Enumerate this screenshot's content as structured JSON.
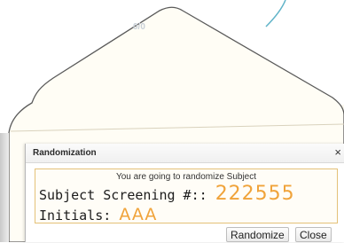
{
  "background": {
    "faint_text": "0/0"
  },
  "dialog": {
    "title": "Randomization",
    "close_glyph": "×",
    "intro": "You are going to randomize Subject",
    "screening_label": "Subject Screening #::",
    "screening_value": "222555",
    "initials_label": "Initials:",
    "initials_value": "AAA",
    "buttons": {
      "randomize": "Randomize",
      "close": "Close"
    }
  },
  "colors": {
    "accent_orange": "#f0a33a",
    "panel_border": "#e4c178"
  },
  "icons": {
    "close": "close-icon"
  }
}
